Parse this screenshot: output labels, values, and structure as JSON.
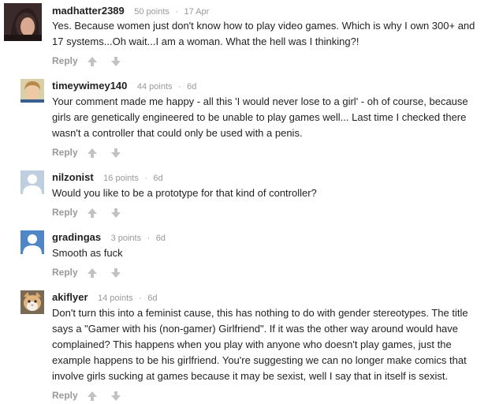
{
  "comments": [
    {
      "username": "madhatter2389",
      "points": "50 points",
      "age": "17 Apr",
      "text": "Yes. Because women just don't know how to play video games. Which is why I own 300+ and 17 systems...Oh wait...I am a woman. What the hell was I thinking?!",
      "reply_label": "Reply",
      "avatar": "user-photo"
    },
    {
      "username": "timeywimey140",
      "points": "44 points",
      "age": "6d",
      "text": "Your comment made me happy - all this 'I would never lose to a girl' - oh of course, because girls are genetically engineered to be unable to play games well... Last time I checked there wasn't a controller that could only be used with a penis.",
      "reply_label": "Reply",
      "avatar": "user-photo"
    },
    {
      "username": "nilzonist",
      "points": "16 points",
      "age": "6d",
      "text": "Would you like to be a prototype for that kind of controller?",
      "reply_label": "Reply",
      "avatar": "default-avatar-gray"
    },
    {
      "username": "gradingas",
      "points": "3 points",
      "age": "6d",
      "text": "Smooth as fuck",
      "reply_label": "Reply",
      "avatar": "default-avatar-blue"
    },
    {
      "username": "akiflyer",
      "points": "14 points",
      "age": "6d",
      "text": "Don't turn this into a feminist cause, this has nothing to do with gender stereotypes. The title says a \"Gamer with his (non-gamer) Girlfriend\". If it was the other way around would have complained? This happens when you play with anyone who doesn't play games, just the example happens to be his girlfriend. You're suggesting we can no longer make comics that involve girls sucking at games because it may be sexist, well I say that in itself is sexist.",
      "reply_label": "Reply",
      "avatar": "cat-photo"
    }
  ],
  "separator": "·",
  "colors": {
    "text": "#222222",
    "meta": "#999999",
    "vote_arrow": "#c2c2c2",
    "avatar_gray": "#bfcfe0",
    "avatar_blue": "#4f86c6"
  }
}
